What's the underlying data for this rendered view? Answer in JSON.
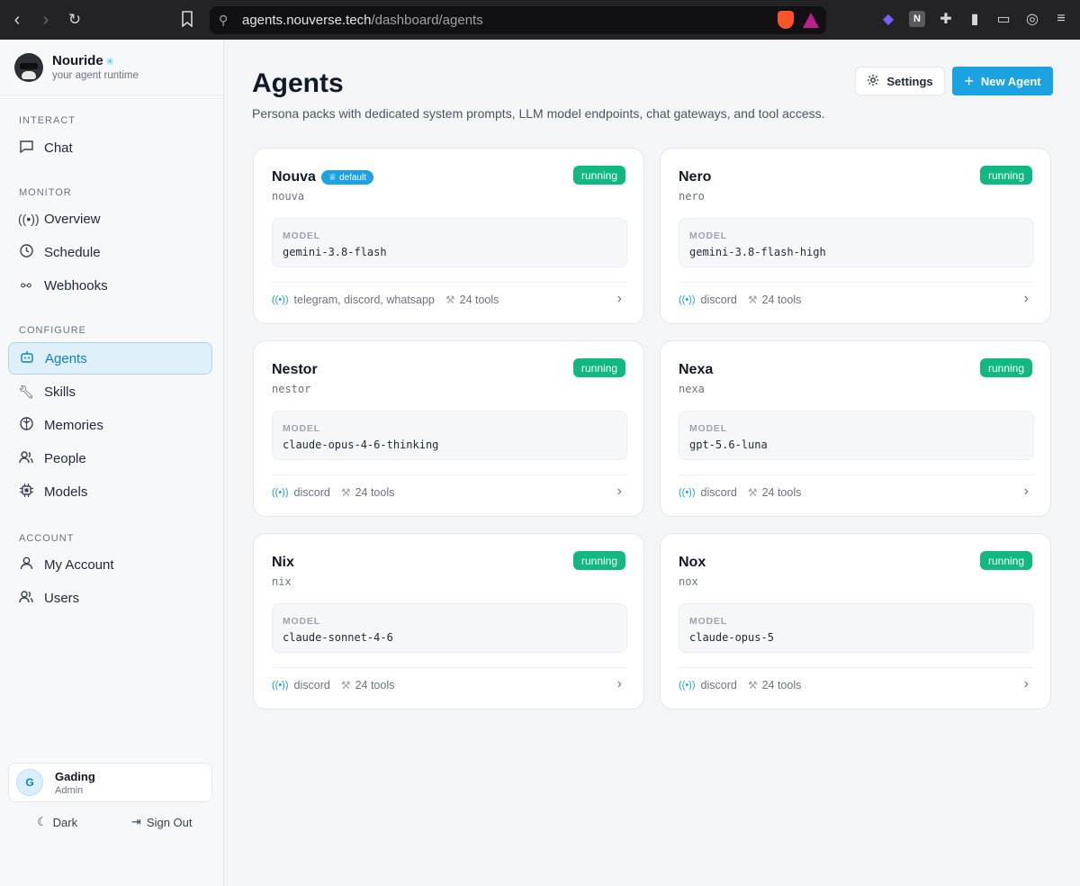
{
  "browser": {
    "url_host": "agents.nouverse.tech",
    "url_path": "/dashboard/agents",
    "n_extension": "N"
  },
  "sidebar": {
    "brand_name": "Nouride",
    "brand_tagline": "your agent runtime",
    "sections": [
      {
        "label": "INTERACT",
        "items": [
          {
            "label": "Chat",
            "icon": "chat-icon"
          }
        ]
      },
      {
        "label": "MONITOR",
        "items": [
          {
            "label": "Overview",
            "icon": "radio-icon"
          },
          {
            "label": "Schedule",
            "icon": "clock-icon"
          },
          {
            "label": "Webhooks",
            "icon": "webhook-icon"
          }
        ]
      },
      {
        "label": "CONFIGURE",
        "items": [
          {
            "label": "Agents",
            "icon": "bot-icon",
            "active": true
          },
          {
            "label": "Skills",
            "icon": "wrench-icon"
          },
          {
            "label": "Memories",
            "icon": "brain-icon"
          },
          {
            "label": "People",
            "icon": "people-icon"
          },
          {
            "label": "Models",
            "icon": "chip-icon"
          }
        ]
      },
      {
        "label": "ACCOUNT",
        "items": [
          {
            "label": "My Account",
            "icon": "user-icon"
          },
          {
            "label": "Users",
            "icon": "users-icon"
          }
        ]
      }
    ],
    "user": {
      "initial": "G",
      "name": "Gading",
      "role": "Admin"
    },
    "dark_label": "Dark",
    "signout_label": "Sign Out"
  },
  "main": {
    "title": "Agents",
    "subtitle": "Persona packs with dedicated system prompts, LLM model endpoints, chat gateways, and tool access.",
    "settings_label": "Settings",
    "new_agent_label": "New Agent",
    "model_label": "MODEL",
    "agents": [
      {
        "name": "Nouva",
        "slug": "nouva",
        "default_badge": "default",
        "status": "running",
        "model": "gemini-3.8-flash",
        "gateways": "telegram, discord, whatsapp",
        "tools": "24 tools"
      },
      {
        "name": "Nero",
        "slug": "nero",
        "status": "running",
        "model": "gemini-3.8-flash-high",
        "gateways": "discord",
        "tools": "24 tools"
      },
      {
        "name": "Nestor",
        "slug": "nestor",
        "status": "running",
        "model": "claude-opus-4-6-thinking",
        "gateways": "discord",
        "tools": "24 tools"
      },
      {
        "name": "Nexa",
        "slug": "nexa",
        "status": "running",
        "model": "gpt-5.6-luna",
        "gateways": "discord",
        "tools": "24 tools"
      },
      {
        "name": "Nix",
        "slug": "nix",
        "status": "running",
        "model": "claude-sonnet-4-6",
        "gateways": "discord",
        "tools": "24 tools"
      },
      {
        "name": "Nox",
        "slug": "nox",
        "status": "running",
        "model": "claude-opus-5",
        "gateways": "discord",
        "tools": "24 tools"
      }
    ]
  },
  "colors": {
    "accent": "#1ba2e0",
    "running": "#10b981",
    "active_nav_bg": "#e0f0fb"
  }
}
